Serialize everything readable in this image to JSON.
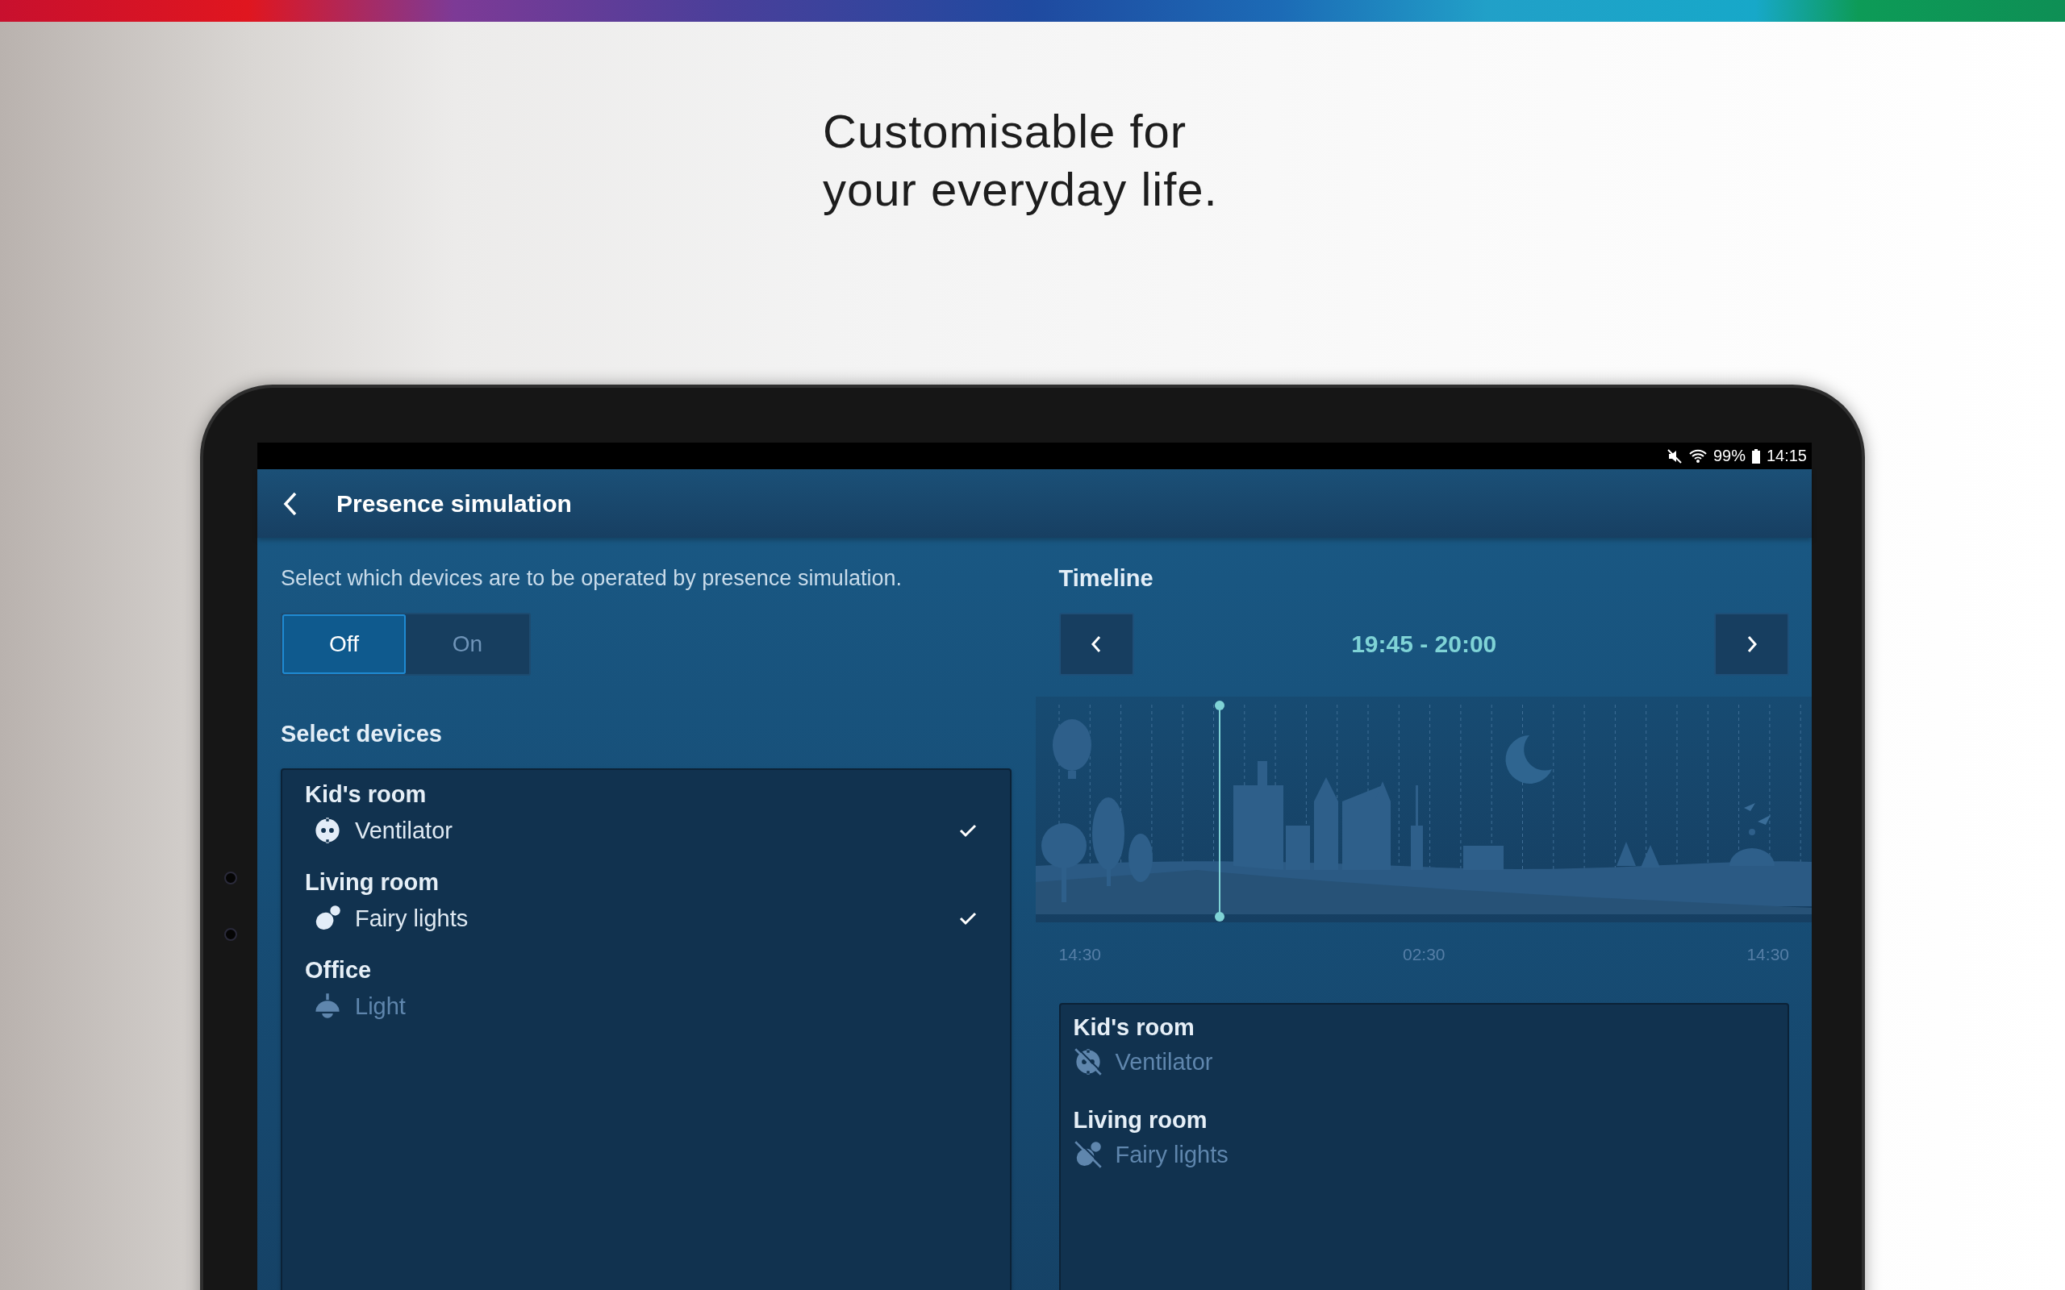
{
  "banner": {
    "headline": [
      "Customisable for",
      "your everyday life."
    ]
  },
  "status_bar": {
    "battery": "99%",
    "time": "14:15"
  },
  "app_bar": {
    "title": "Presence simulation"
  },
  "intro": "Select which devices are to be operated by presence simulation.",
  "mode_toggle": [
    {
      "label": "Off",
      "selected": true
    },
    {
      "label": "On",
      "selected": false
    }
  ],
  "device_section": {
    "title": "Select devices",
    "rooms": [
      {
        "name": "Kid's room",
        "devices": [
          {
            "name": "Ventilator",
            "kind": "socket",
            "checked": true,
            "disabled": false
          }
        ]
      },
      {
        "name": "Living room",
        "devices": [
          {
            "name": "Fairy lights",
            "kind": "bulb",
            "checked": true,
            "disabled": false
          }
        ]
      },
      {
        "name": "Office",
        "devices": [
          {
            "name": "Light",
            "kind": "lamp",
            "checked": false,
            "disabled": true
          }
        ]
      }
    ]
  },
  "timeline": {
    "title": "Timeline",
    "range": "19:45 - 20:00",
    "scrubber": {
      "level": 0.22
    },
    "axis_labels": [
      "14:30",
      "02:30",
      "14:30"
    ],
    "rooms": [
      {
        "name": "Kid's room",
        "devices": [
          {
            "name": "Ventilator",
            "kind": "socket",
            "active": false
          }
        ]
      },
      {
        "name": "Living room",
        "devices": [
          {
            "name": "Fairy lights",
            "kind": "bulb",
            "active": false
          }
        ]
      }
    ]
  }
}
